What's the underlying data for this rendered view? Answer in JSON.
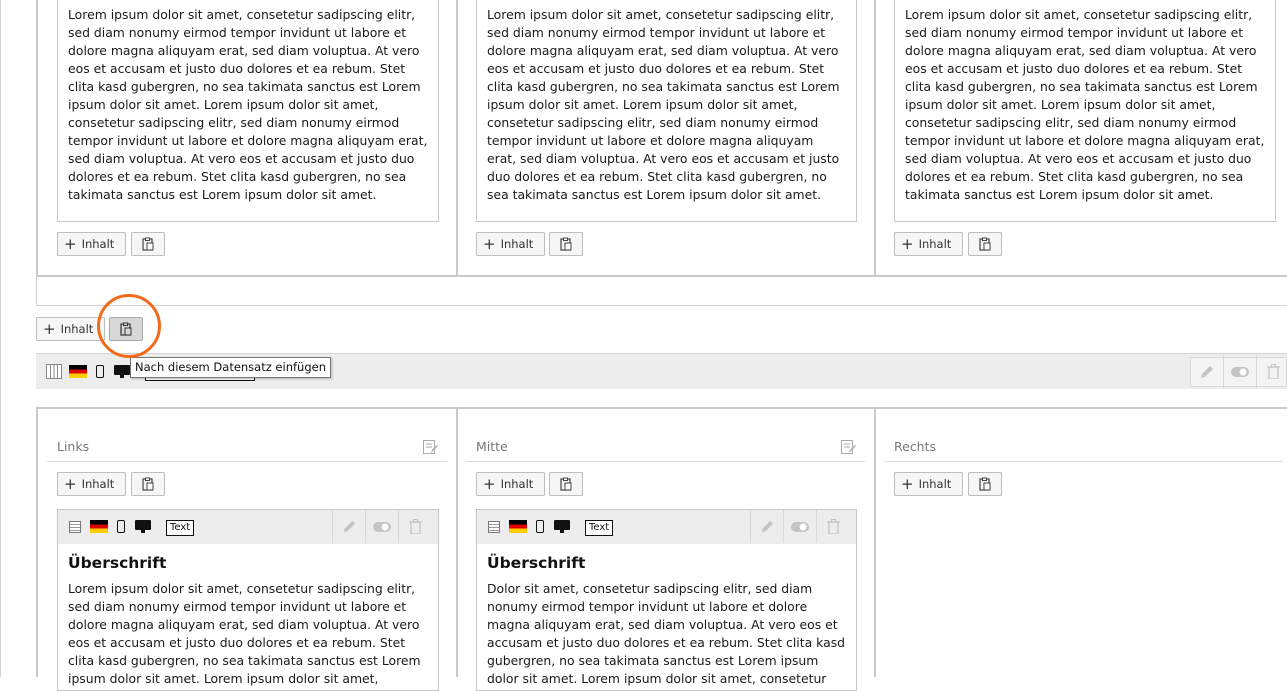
{
  "lorem_full": "Lorem ipsum dolor sit amet, consetetur sadipscing elitr, sed diam nonumy eirmod tempor invidunt ut labore et dolore magna aliquyam erat, sed diam voluptua. At vero eos et accusam et justo duo dolores et ea rebum. Stet clita kasd gubergren, no sea takimata sanctus est Lorem ipsum dolor sit amet. Lorem ipsum dolor sit amet, consetetur sadipscing elitr, sed diam nonumy eirmod tempor invidunt ut labore et dolore magna aliquyam erat, sed diam voluptua. At vero eos et accusam et justo duo dolores et ea rebum. Stet clita kasd gubergren, no sea takimata sanctus est Lorem ipsum dolor sit amet.",
  "buttons": {
    "add_content_label": "Inhalt"
  },
  "tooltip": {
    "paste_after": "Nach diesem Datensatz einfügen"
  },
  "columns": {
    "left": "Links",
    "middle": "Mitte",
    "right": "Rechts"
  },
  "lower_cards": {
    "left": {
      "ctype_badge": "Text",
      "title": "Überschrift",
      "text": "Lorem ipsum dolor sit amet, consetetur sadipscing elitr, sed diam nonumy eirmod tempor invidunt ut labore et dolore magna aliquyam erat, sed diam voluptua. At vero eos et accusam et justo duo dolores et ea rebum. Stet clita kasd gubergren, no sea takimata sanctus est Lorem ipsum dolor sit amet. Lorem ipsum dolor sit amet,"
    },
    "middle": {
      "ctype_badge": "Text",
      "title": "Überschrift",
      "text": "Dolor sit amet, consetetur sadipscing elitr, sed diam nonumy eirmod tempor invidunt ut labore et dolore magna aliquyam erat, sed diam voluptua. At vero eos et accusam et justo duo dolores et ea rebum. Stet clita kasd gubergren, no sea takimata sanctus est Lorem ipsum dolor sit amet. Lorem ipsum dolor sit amet, consetetur"
    }
  },
  "icons": {
    "paste": "clipboard-paste-icon",
    "edit": "pencil-icon",
    "toggle": "toggle-visibility-icon",
    "delete": "trash-icon",
    "flag": "german-flag-icon",
    "mobile": "mobile-device-icon",
    "desktop": "desktop-device-icon",
    "grid": "grid-container-icon",
    "text_type": "text-content-type-icon",
    "column_edit": "column-edit-icon"
  },
  "colors": {
    "highlight_ring": "#f26b1d",
    "border": "#c9c9c9",
    "header_bg": "#ededed"
  }
}
